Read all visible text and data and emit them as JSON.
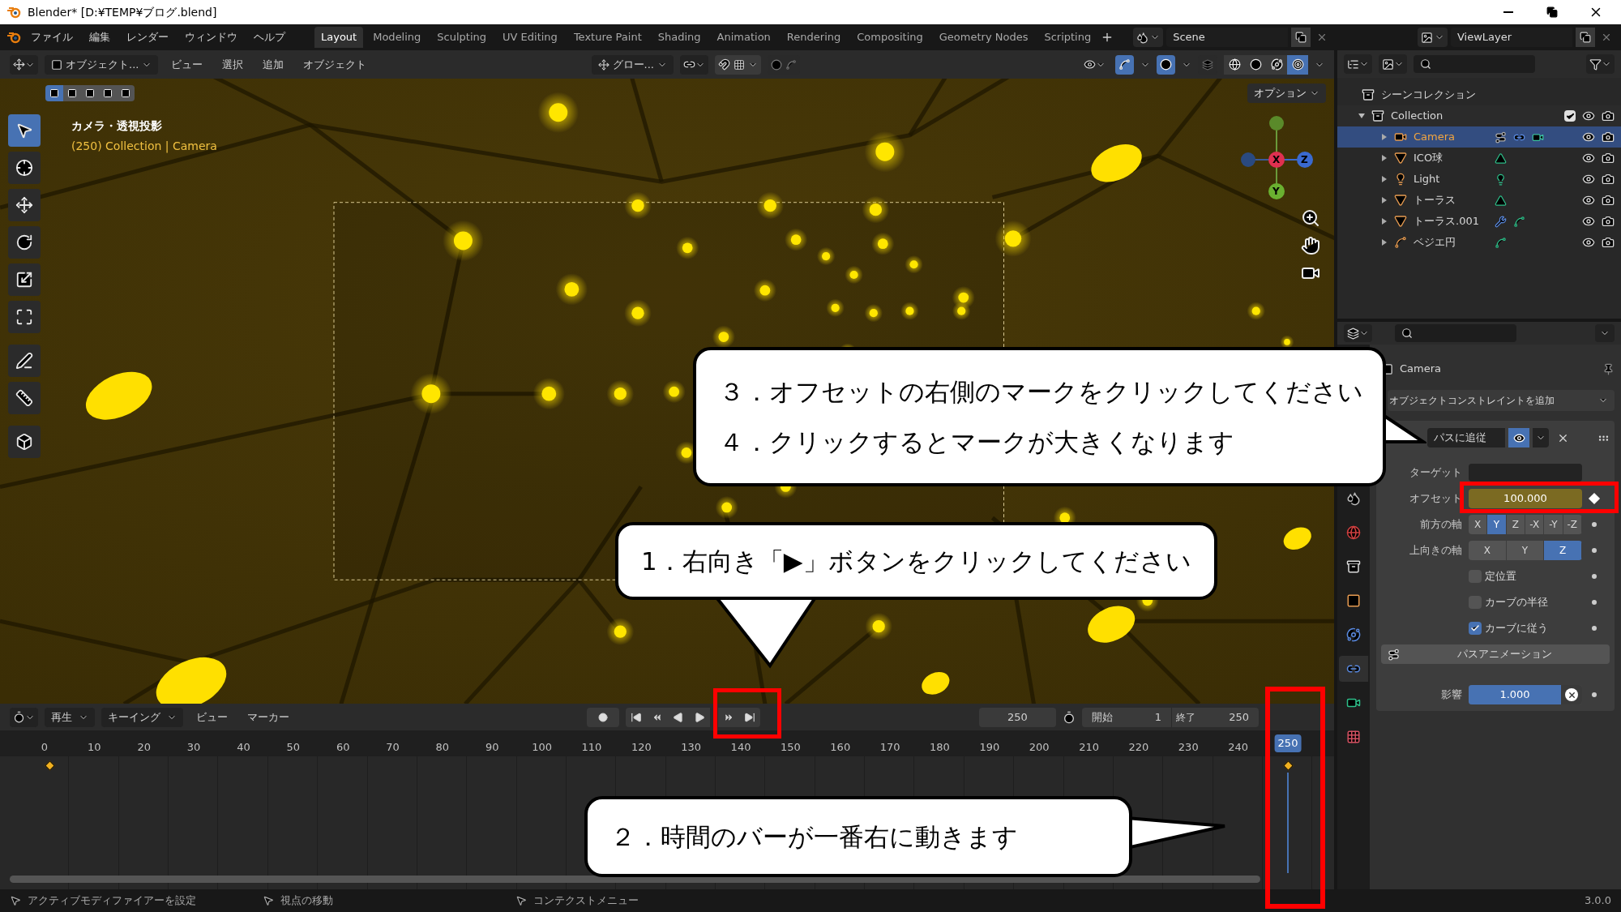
{
  "window": {
    "title": "Blender* [D:¥TEMP¥ブログ.blend]"
  },
  "menu": [
    "ファイル",
    "編集",
    "レンダー",
    "ウィンドウ",
    "ヘルプ"
  ],
  "workspaces": [
    {
      "label": "Layout",
      "selected": true
    },
    {
      "label": "Modeling",
      "selected": false
    },
    {
      "label": "Sculpting",
      "selected": false
    },
    {
      "label": "UV Editing",
      "selected": false
    },
    {
      "label": "Texture Paint",
      "selected": false
    },
    {
      "label": "Shading",
      "selected": false
    },
    {
      "label": "Animation",
      "selected": false
    },
    {
      "label": "Rendering",
      "selected": false
    },
    {
      "label": "Compositing",
      "selected": false
    },
    {
      "label": "Geometry Nodes",
      "selected": false
    },
    {
      "label": "Scripting",
      "selected": false
    }
  ],
  "scene": "Scene",
  "view_layer": "ViewLayer",
  "viewport": {
    "mode": "オブジェクト...",
    "menus": [
      "ビュー",
      "選択",
      "追加",
      "オブジェクト"
    ],
    "orientation": "グロー...",
    "options": "オプション",
    "overlay_title": "カメラ・透視投影",
    "overlay_subtitle": "(250) Collection | Camera",
    "gizmo": [
      "X",
      "Y",
      "Z"
    ],
    "select_modes": [
      {
        "selected": true
      },
      {
        "selected": false
      },
      {
        "selected": false
      },
      {
        "selected": false
      },
      {
        "selected": false
      }
    ],
    "shading": [
      {
        "kind": "wireframe",
        "selected": false
      },
      {
        "kind": "solid",
        "selected": false
      },
      {
        "kind": "material",
        "selected": false
      },
      {
        "kind": "rendered",
        "selected": true
      }
    ],
    "tools": [
      {
        "kind": "select",
        "selected": true
      },
      {
        "kind": "cursor",
        "selected": false
      },
      {
        "kind": "move",
        "selected": false
      },
      {
        "kind": "rotate",
        "selected": false
      },
      {
        "kind": "scale",
        "selected": false
      },
      {
        "kind": "transform",
        "selected": false
      },
      {
        "kind": "annotate",
        "selected": false
      },
      {
        "kind": "measure",
        "selected": false
      },
      {
        "kind": "add-cube",
        "selected": false
      }
    ]
  },
  "outliner": {
    "root": "シーンコレクション",
    "collection": {
      "name": "Collection",
      "expanded": true,
      "checked": true,
      "children": [
        {
          "name": "Camera",
          "kind": "camera",
          "selected": true,
          "extras": [
            {
              "kind": "constraint"
            },
            {
              "kind": "constraint-data"
            },
            {
              "kind": "camera-data"
            }
          ]
        },
        {
          "name": "ICO球",
          "kind": "mesh",
          "selected": false,
          "extras": [
            {
              "kind": "mesh-data"
            }
          ]
        },
        {
          "name": "Light",
          "kind": "light",
          "selected": false,
          "extras": [
            {
              "kind": "light-data"
            }
          ]
        },
        {
          "name": "トーラス",
          "kind": "mesh",
          "selected": false,
          "extras": [
            {
              "kind": "mesh-data"
            }
          ]
        },
        {
          "name": "トーラス.001",
          "kind": "mesh",
          "selected": false,
          "extras": [
            {
              "kind": "modifier"
            },
            {
              "kind": "hook-data"
            }
          ]
        },
        {
          "name": "ベジエ円",
          "kind": "curve",
          "selected": false,
          "extras": [
            {
              "kind": "curve-data"
            }
          ]
        }
      ]
    }
  },
  "properties": {
    "tabs": [
      {
        "kind": "scene",
        "selected": false
      },
      {
        "kind": "world",
        "selected": false
      },
      {
        "kind": "collection",
        "selected": false
      },
      {
        "kind": "object",
        "selected": false
      },
      {
        "kind": "physics",
        "selected": false
      },
      {
        "kind": "constraints",
        "selected": true
      },
      {
        "kind": "camera-data",
        "selected": false
      },
      {
        "kind": "texture",
        "selected": false
      }
    ],
    "object": "Camera",
    "add_constraint": "オブジェクトコンストレイントを追加",
    "constraint": {
      "name": "パスに追従",
      "enabled": true,
      "target_label": "ターゲット",
      "offset": {
        "label": "オフセット",
        "value": "100.000",
        "keyframed": true
      },
      "forward_axis": {
        "label": "前方の軸",
        "options": [
          {
            "label": "X",
            "selected": false
          },
          {
            "label": "Y",
            "selected": true
          },
          {
            "label": "Z",
            "selected": false
          },
          {
            "label": "-X",
            "selected": false
          },
          {
            "label": "-Y",
            "selected": false
          },
          {
            "label": "-Z",
            "selected": false
          }
        ]
      },
      "up_axis": {
        "label": "上向きの軸",
        "options": [
          {
            "label": "X",
            "selected": false
          },
          {
            "label": "Y",
            "selected": false
          },
          {
            "label": "Z",
            "selected": true
          }
        ]
      },
      "checkboxes": [
        {
          "label": "定位置",
          "checked": false
        },
        {
          "label": "カーブの半径",
          "checked": false
        },
        {
          "label": "カーブに従う",
          "checked": true
        }
      ],
      "animate_button": "パスアニメーション",
      "influence": {
        "label": "影響",
        "value": "1.000",
        "level": 1
      }
    }
  },
  "timeline": {
    "menus": [
      "再生",
      "キーイング",
      "ビュー",
      "マーカー"
    ],
    "current_frame": "250",
    "start_label": "開始",
    "start": "1",
    "end_label": "終了",
    "end": "250",
    "ticks": [
      "0",
      "10",
      "20",
      "30",
      "40",
      "50",
      "60",
      "70",
      "80",
      "90",
      "100",
      "110",
      "120",
      "130",
      "140",
      "150",
      "160",
      "170",
      "180",
      "190",
      "200",
      "210",
      "220",
      "230",
      "240"
    ],
    "playhead": "250"
  },
  "status_bar": {
    "hints": [
      "アクティブモディファイアーを設定",
      "視点の移動",
      "コンテクストメニュー"
    ],
    "version": "3.0.0"
  },
  "callouts": [
    {
      "kind": "tail-right",
      "lines": [
        "３．オフセットの右側のマークをクリックしてください",
        "４．クリックするとマークが大きくなります"
      ]
    },
    {
      "kind": "tail-down",
      "lines": [
        "1．右向き「▶」ボタンをクリックしてください"
      ]
    },
    {
      "kind": "tail-right",
      "lines": [
        "２．時間のバーが一番右に動きます"
      ]
    }
  ]
}
